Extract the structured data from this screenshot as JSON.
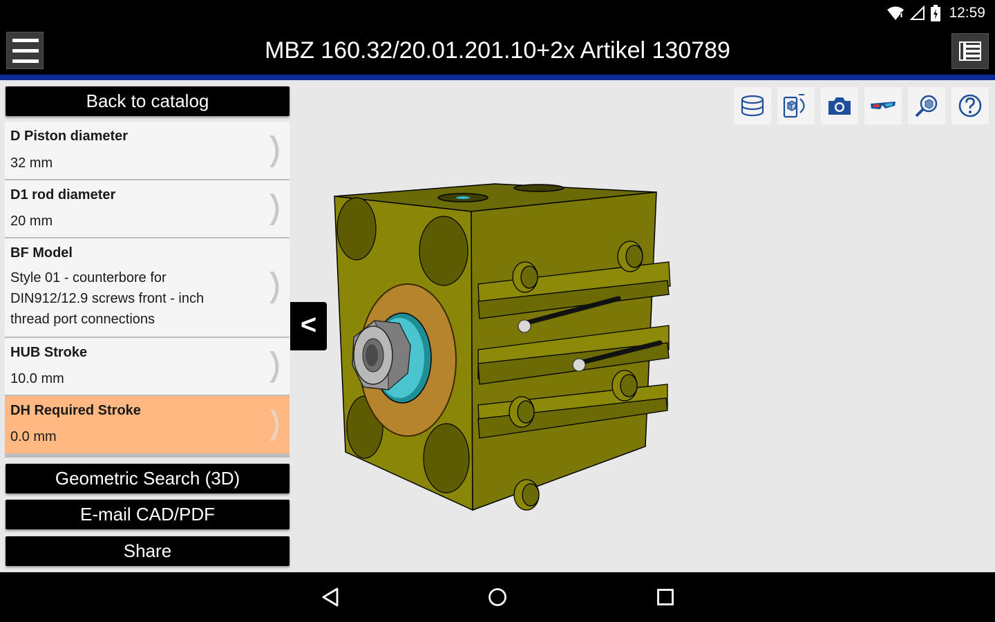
{
  "status_bar": {
    "time": "12:59",
    "icons": [
      "wifi-icon",
      "signal-icon",
      "battery-icon"
    ]
  },
  "header": {
    "title": "MBZ 160.32/20.01.201.10+2x Artikel 130789",
    "accent_color": "#0b2a91"
  },
  "sidebar": {
    "back_label": "Back to catalog",
    "params": [
      {
        "name": "D Piston diameter",
        "value": "32 mm",
        "highlighted": false
      },
      {
        "name": "D1 rod diameter",
        "value": "20 mm",
        "highlighted": false
      },
      {
        "name": "BF Model",
        "value_lines": [
          "Style 01 - counterbore for",
          "DIN912/12.9 screws front - inch",
          "thread port connections"
        ],
        "highlighted": false
      },
      {
        "name": "HUB Stroke",
        "value": "10.0 mm",
        "highlighted": false
      },
      {
        "name": "DH Required Stroke",
        "value": "0.0 mm",
        "highlighted": true
      }
    ],
    "highlight_color": "#ffb882",
    "geometric_search_label": "Geometric Search (3D)",
    "email_label": "E-mail CAD/PDF",
    "share_label": "Share",
    "collapse_label": "<"
  },
  "toolbar": {
    "tools": [
      "cylinder-icon",
      "ar-device-icon",
      "camera-icon",
      "3d-glasses-icon",
      "zoom-part-icon",
      "help-icon"
    ]
  },
  "navbar": {
    "buttons": [
      "back-nav-icon",
      "home-nav-icon",
      "recents-nav-icon"
    ]
  }
}
